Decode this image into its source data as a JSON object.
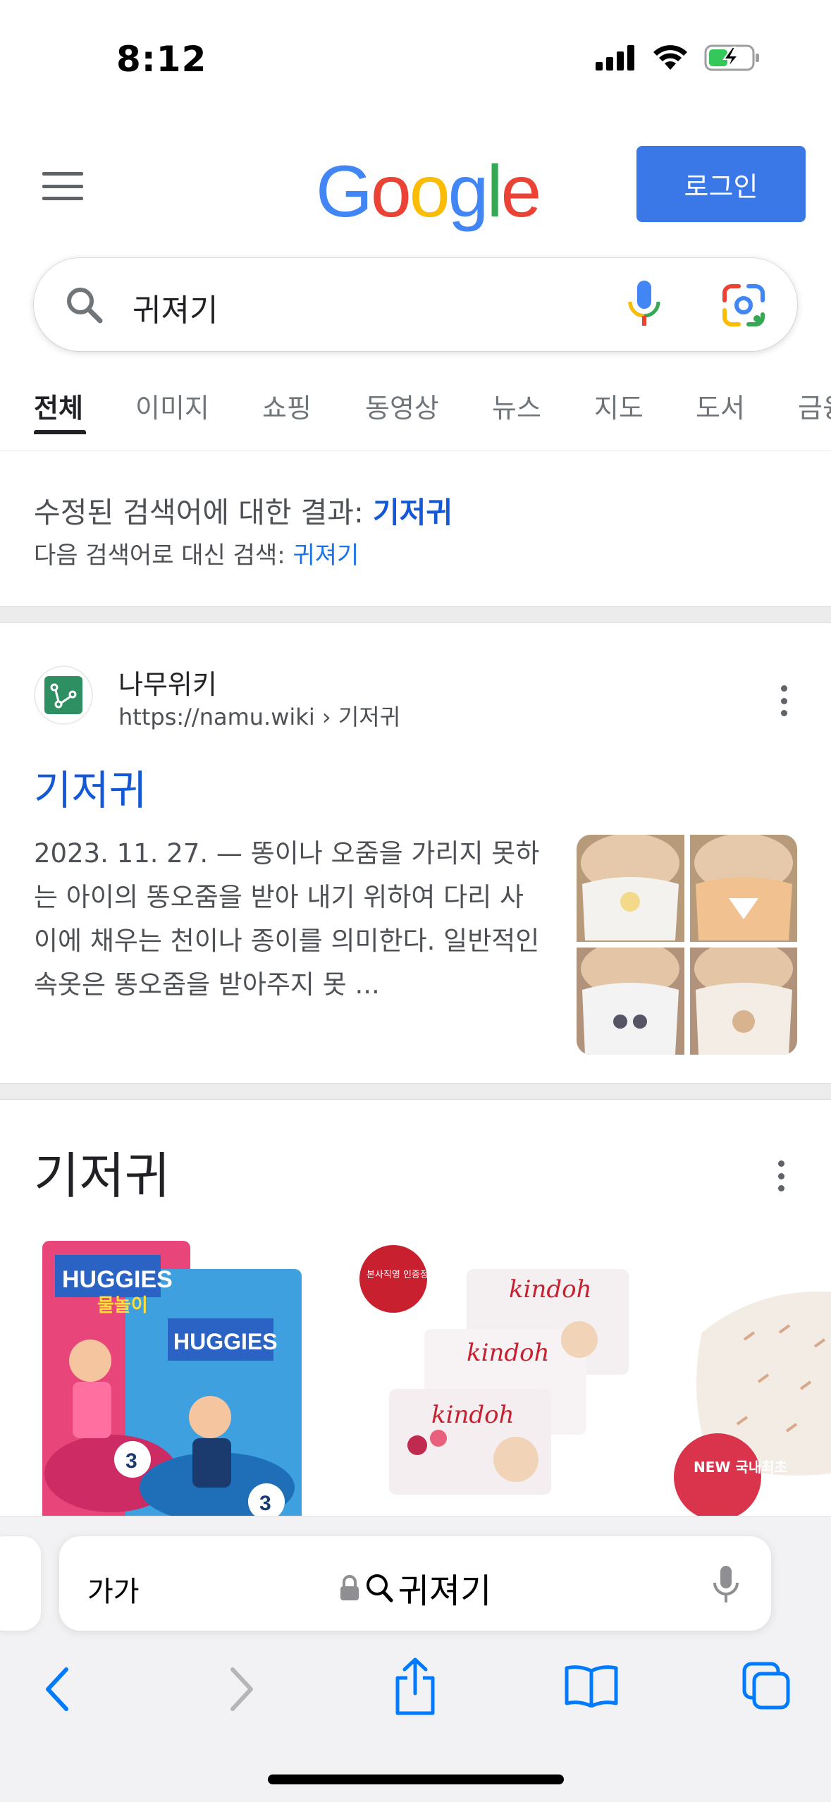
{
  "status_bar": {
    "time": "8:12"
  },
  "header": {
    "logo": "Google",
    "login_label": "로그인"
  },
  "search": {
    "query": "귀져기"
  },
  "tabs": [
    {
      "label": "전체",
      "active": true
    },
    {
      "label": "이미지"
    },
    {
      "label": "쇼핑"
    },
    {
      "label": "동영상"
    },
    {
      "label": "뉴스"
    },
    {
      "label": "지도"
    },
    {
      "label": "도서"
    },
    {
      "label": "금융"
    }
  ],
  "correction": {
    "prefix": "수정된 검색어에 대한 결과: ",
    "corrected": "기저귀",
    "instead_prefix": "다음 검색어로 대신 검색: ",
    "original": "귀져기"
  },
  "result": {
    "site_name": "나무위키",
    "url": "https://namu.wiki",
    "breadcrumb": " › 기저귀",
    "title": "기저귀",
    "snippet": "2023. 11. 27. — 똥이나 오줌을 가리지 못하는 아이의 똥오줌을 받아 내기 위하여 다리 사이에 채우는 천이나 종이를 의미한다. 일반적인 속옷은 똥오줌을 받아주지 못 ..."
  },
  "shopping": {
    "title": "기저귀",
    "products": [
      {
        "brand": "HUGGIES",
        "sub": "물놀이",
        "size": "3"
      },
      {
        "brand": "kindoh",
        "badge": "본사직영 인증정품"
      },
      {
        "badge": "NEW 국내최초"
      }
    ]
  },
  "safari": {
    "text_size": "가가",
    "address": "귀져기"
  },
  "colors": {
    "google_blue": "#4285F4",
    "google_red": "#EA4335",
    "google_yellow": "#FBBC05",
    "google_green": "#34A853",
    "link": "#1558d6",
    "ios_blue": "#007AFF"
  }
}
